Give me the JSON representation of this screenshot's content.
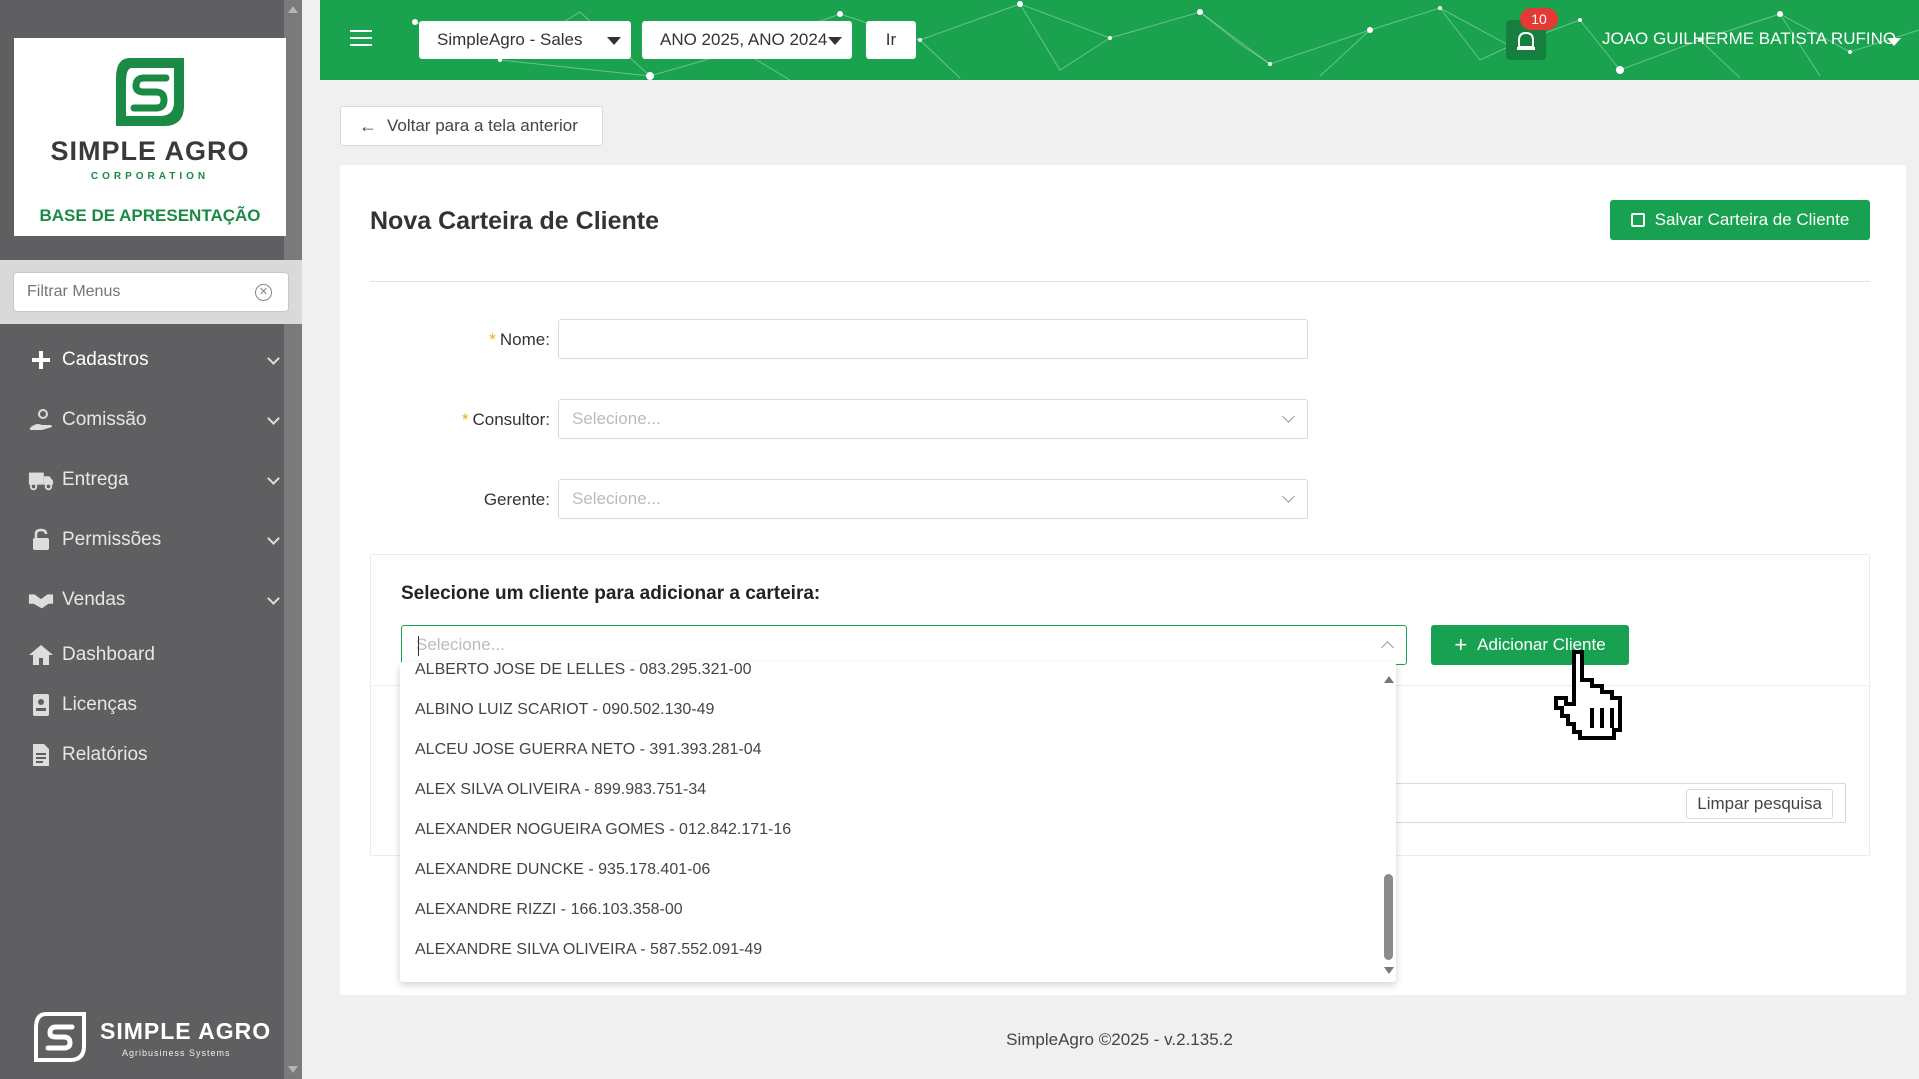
{
  "sidebar": {
    "logo": {
      "name": "SIMPLE AGRO",
      "corporation": "CORPORATION",
      "base_label": "BASE DE APRESENTAÇÃO"
    },
    "filter_placeholder": "Filtrar Menus",
    "items": [
      {
        "label": "Cadastros",
        "icon": "plus-icon",
        "has_chevron": true
      },
      {
        "label": "Comissão",
        "icon": "hand-coin-icon",
        "has_chevron": true
      },
      {
        "label": "Entrega",
        "icon": "truck-icon",
        "has_chevron": true
      },
      {
        "label": "Permissões",
        "icon": "unlock-icon",
        "has_chevron": true
      },
      {
        "label": "Vendas",
        "icon": "handshake-icon",
        "has_chevron": true
      },
      {
        "label": "Dashboard",
        "icon": "home-icon",
        "has_chevron": false
      },
      {
        "label": "Licenças",
        "icon": "id-card-icon",
        "has_chevron": false
      },
      {
        "label": "Relatórios",
        "icon": "report-icon",
        "has_chevron": false
      }
    ],
    "footer_brand": {
      "name": "SIMPLE AGRO",
      "subtitle": "Agribusiness Systems"
    }
  },
  "topbar": {
    "app_select": "SimpleAgro - Sales",
    "year_select": "ANO 2025, ANO 2024",
    "go_label": "Ir",
    "notifications_count": "10",
    "user_name": "JOAO GUILHERME BATISTA RUFINO",
    "accent_color": "#1aa24f"
  },
  "back_button": "Voltar para a tela anterior",
  "page": {
    "title": "Nova Carteira de Cliente",
    "save_label": "Salvar Carteira de Cliente",
    "fields": {
      "nome": {
        "label": "Nome",
        "value": "",
        "required": true
      },
      "consultor": {
        "label": "Consultor",
        "placeholder": "Selecione...",
        "required": true
      },
      "gerente": {
        "label": "Gerente",
        "placeholder": "Selecione...",
        "required": false
      }
    },
    "client_section": {
      "title": "Selecione um cliente para adicionar a carteira:",
      "select_placeholder": "Selecione...",
      "add_label": "Adicionar Cliente",
      "clear_label": "Limpar pesquisa"
    }
  },
  "dropdown_options": [
    "ALBERTO JOSE DE LELLES - 083.295.321-00",
    "ALBINO LUIZ SCARIOT - 090.502.130-49",
    "ALCEU JOSE GUERRA NETO - 391.393.281-04",
    "ALEX SILVA OLIVEIRA - 899.983.751-34",
    "ALEXANDER NOGUEIRA GOMES - 012.842.171-16",
    "ALEXANDRE DUNCKE - 935.178.401-06",
    "ALEXANDRE RIZZI - 166.103.358-00",
    "ALEXANDRE SILVA OLIVEIRA - 587.552.091-49"
  ],
  "footer": "SimpleAgro ©2025 - v.2.135.2"
}
